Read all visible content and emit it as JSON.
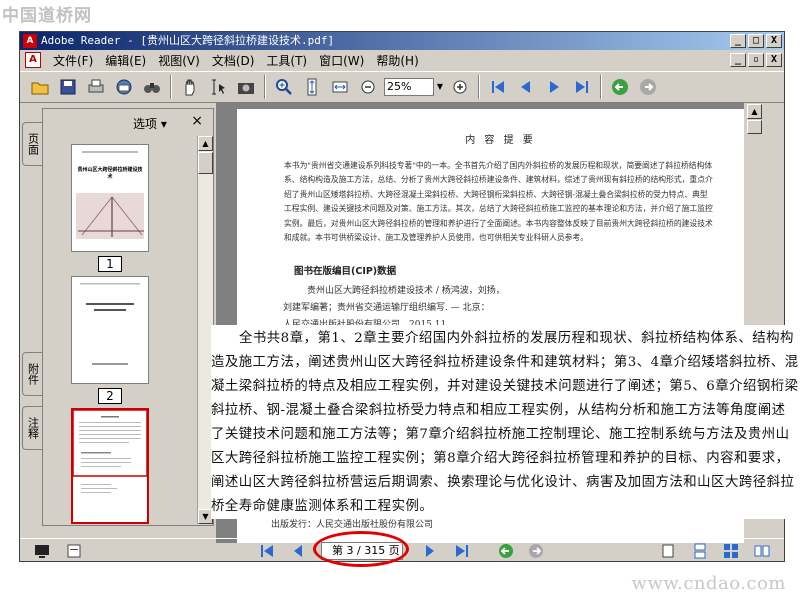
{
  "watermark_top": "中国道桥网",
  "watermark_bottom": "www.cndao.com",
  "window": {
    "app_icon": "A",
    "title": "Adobe Reader - [贵州山区大跨径斜拉桥建设技术.pdf]",
    "min": "_",
    "max": "□",
    "close": "X"
  },
  "menu": {
    "items": [
      "文件(F)",
      "编辑(E)",
      "视图(V)",
      "文档(D)",
      "工具(T)",
      "窗口(W)",
      "帮助(H)"
    ],
    "doc_min": "_",
    "doc_restore": "▫",
    "doc_close": "X"
  },
  "toolbar": {
    "zoom": "25%",
    "zoom_arrow": "▼"
  },
  "side_tabs": {
    "pages": "页面",
    "attachments": "附件",
    "comments": "注释"
  },
  "nav": {
    "options": "选项 ▾",
    "close": "×",
    "thumb_labels": [
      "1",
      "2"
    ],
    "thumb1_title": "贵州山区大跨径斜拉桥建设技术"
  },
  "page": {
    "heading": "内 容 提 要",
    "summary": "本书为\"贵州省交通建设系列科技专著\"中的一本。全书首先介绍了国内外斜拉桥的发展历程和现状，简要阐述了斜拉桥结构体系、结构构造及施工方法，总结、分析了贵州大跨径斜拉桥建设条件、建筑材料，综述了贵州现有斜拉桥的结构形式，重点介绍了贵州山区矮塔斜拉桥、大跨径混凝土梁斜拉桥、大跨径钢桁梁斜拉桥、大跨径钢-混凝土叠合梁斜拉桥的受力特点、典型工程实例、建设关键技术问题及对策、施工方法。其次，总结了大跨径斜拉桥施工监控的基本理论和方法，并介绍了施工监控实例。最后，对贵州山区大跨径斜拉桥的管理和养护进行了全面阐述。本书内容整体反映了目前贵州大跨径斜拉桥的建设技术和成就。本书可供桥梁设计、施工及管理养护人员使用，也可供相关专业科研人员参考。",
    "cip_title": "图书在版编目(CIP)数据",
    "cip_line1": "贵州山区大跨径斜拉桥建设技术 / 杨鸿波，刘扬，",
    "cip_line2": "刘建军编著；贵州省交通运输厅组织编写. — 北京：",
    "cip_line3": "人民交通出版社股份有限公司，2015.11",
    "publisher": "出版发行：人民交通出版社股份有限公司"
  },
  "overlay_text": "全书共8章，第1、2章主要介绍国内外斜拉桥的发展历程和现状、斜拉桥结构体系、结构构造及施工方法，阐述贵州山区大跨径斜拉桥建设条件和建筑材料；第3、4章介绍矮塔斜拉桥、混凝土梁斜拉桥的特点及相应工程实例，并对建设关键技术问题进行了阐述；第5、6章介绍钢桁梁斜拉桥、钢-混凝土叠合梁斜拉桥受力特点和相应工程实例，从结构分析和施工方法等角度阐述了关键技术问题和施工方法等；第7章介绍斜拉桥施工控制理论、施工控制系统与方法及贵州山区大跨径斜拉桥施工监控工程实例；第8章介绍大跨径斜拉桥管理和养护的目标、内容和要求，阐述山区大跨径斜拉桥营运后期调索、换索理论与优化设计、病害及加固方法和山区大跨径斜拉桥全寿命健康监测体系和工程实例。",
  "status": {
    "page_indicator": "第 3 / 315 页"
  },
  "colors": {
    "highlight": "#e20000",
    "title_gradient_start": "#0a246a"
  }
}
